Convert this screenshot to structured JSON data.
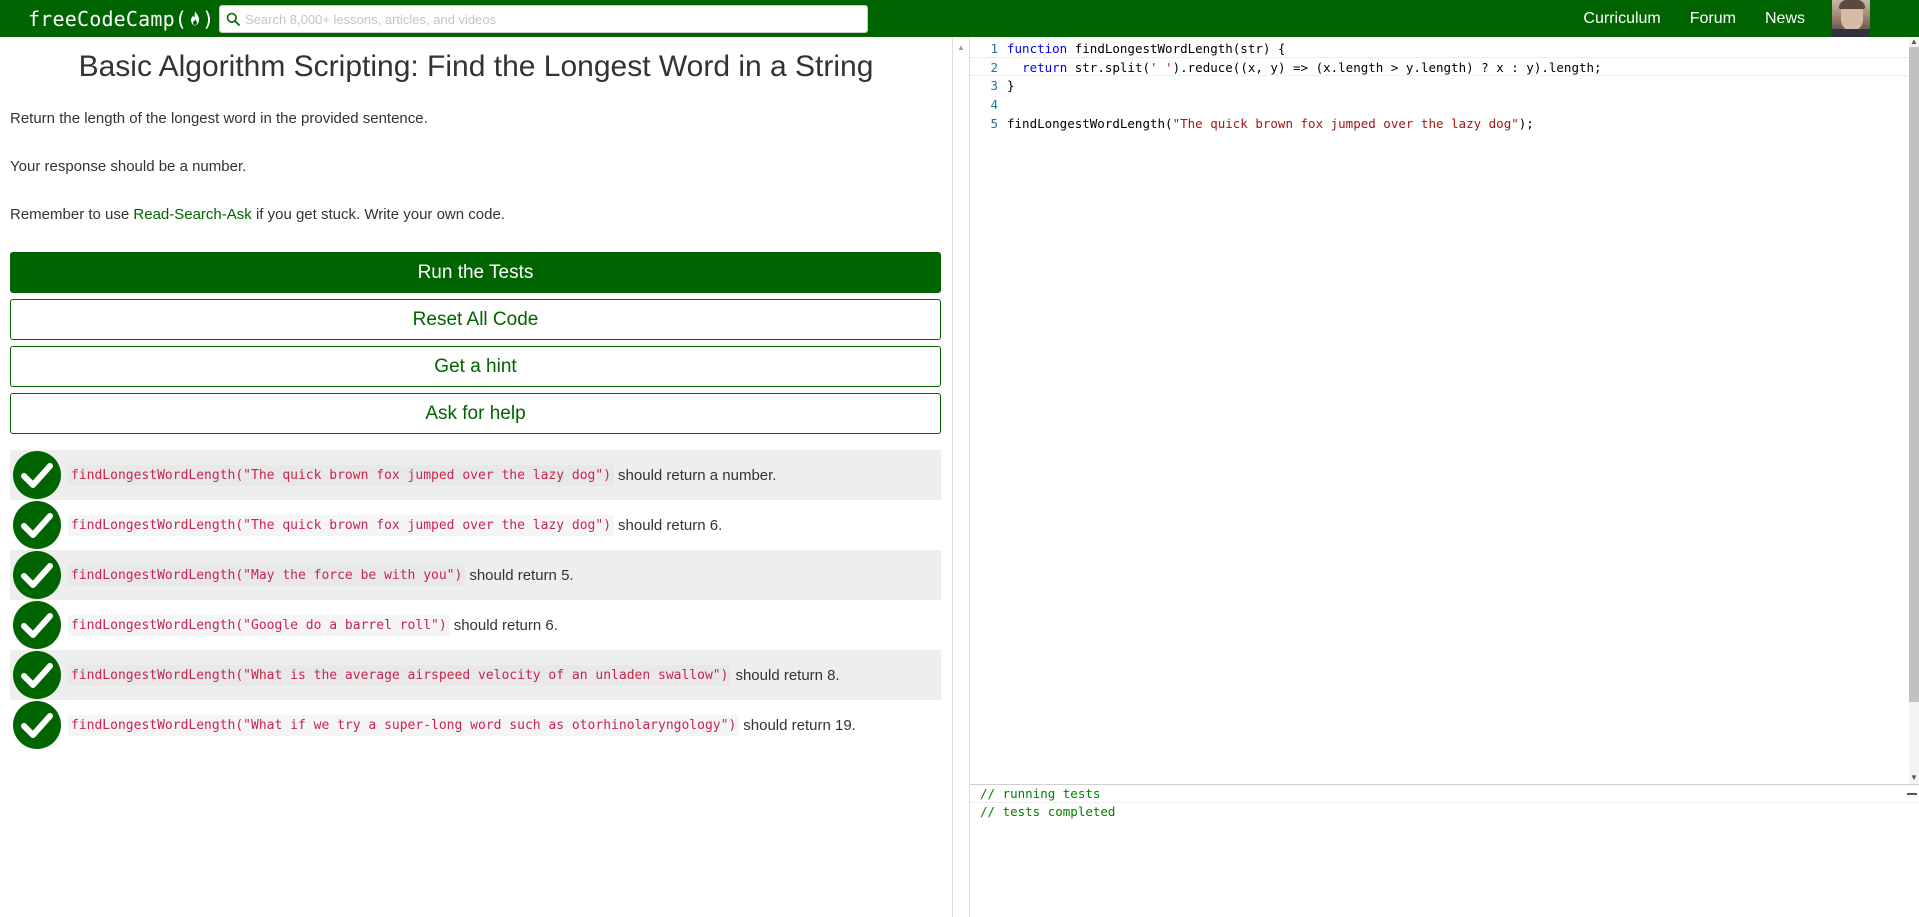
{
  "nav": {
    "logo_text": "freeCodeCamp(",
    "logo_close": ")",
    "search_placeholder": "Search 8,000+ lessons, articles, and videos",
    "links": [
      "Curriculum",
      "Forum",
      "News"
    ]
  },
  "challenge": {
    "title": "Basic Algorithm Scripting: Find the Longest Word in a String",
    "description": "Return the length of the longest word in the provided sentence.",
    "note": "Your response should be a number.",
    "reminder_before": "Remember to use ",
    "reminder_link": "Read-Search-Ask",
    "reminder_after": " if you get stuck. Write your own code."
  },
  "buttons": {
    "run": "Run the Tests",
    "reset": "Reset All Code",
    "hint": "Get a hint",
    "help": "Ask for help"
  },
  "tests": [
    {
      "code": "findLongestWordLength(\"The quick brown fox jumped over the lazy dog\")",
      "text": "should return a number.",
      "passed": true
    },
    {
      "code": "findLongestWordLength(\"The quick brown fox jumped over the lazy dog\")",
      "text": "should return 6.",
      "passed": true
    },
    {
      "code": "findLongestWordLength(\"May the force be with you\")",
      "text": "should return 5.",
      "passed": true
    },
    {
      "code": "findLongestWordLength(\"Google do a barrel roll\")",
      "text": "should return 6.",
      "passed": true
    },
    {
      "code": "findLongestWordLength(\"What is the average airspeed velocity of an unladen swallow\")",
      "text": "should return 8.",
      "passed": true
    },
    {
      "code": "findLongestWordLength(\"What if we try a super-long word such as otorhinolaryngology\")",
      "text": "should return 19.",
      "passed": true
    }
  ],
  "editor": {
    "line_numbers": [
      "1",
      "2",
      "3",
      "4",
      "5"
    ],
    "line1_kw": "function",
    "line1_rest": " findLongestWordLength(str) {",
    "line2_indent": "  ",
    "line2_kw": "return",
    "line2_a": " str.split(",
    "line2_str": "' '",
    "line2_b": ").reduce((x, y) => (x.length > y.length) ? x : y).length;",
    "line3": "}",
    "line4": "",
    "line5_a": "findLongestWordLength(",
    "line5_str": "\"The quick brown fox jumped over the lazy dog\"",
    "line5_b": ");"
  },
  "console": {
    "lines": [
      "// running tests",
      "// tests completed"
    ]
  },
  "colors": {
    "brand_green": "#006400",
    "code_red": "#c7254e",
    "console_green": "#008000",
    "keyword_blue": "#0000ff",
    "string_red": "#a31515",
    "line_number": "#237893"
  }
}
